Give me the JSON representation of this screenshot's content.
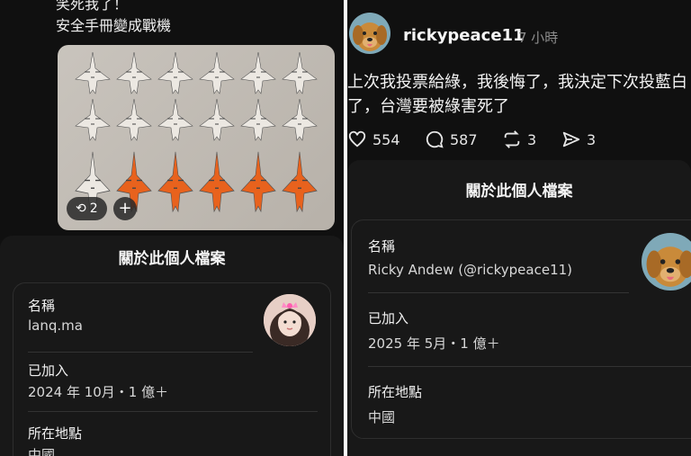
{
  "left": {
    "post_lines": [
      "笑死我了！",
      "安全手冊變成戰機"
    ],
    "media": {
      "repost_count": "2",
      "add_label": "+"
    },
    "profile_sheet": {
      "title": "關於此個人檔案",
      "name_label": "名稱",
      "name_value": "lanq.ma",
      "joined_label": "已加入",
      "joined_value": "2024 年 10月・1 億＋",
      "location_label": "所在地點",
      "location_value": "中國"
    }
  },
  "right": {
    "post": {
      "username": "rickypeace11",
      "time": "7 小時",
      "body": "上次我投票給綠，我後悔了，我決定下次投藍白了，台灣要被綠害死了",
      "likes": "554",
      "comments": "587",
      "reposts": "3",
      "shares": "3"
    },
    "profile_sheet": {
      "title": "關於此個人檔案",
      "name_label": "名稱",
      "name_value": "Ricky Andew (@rickypeace11)",
      "joined_label": "已加入",
      "joined_value": "2025 年 5月・1 億＋",
      "location_label": "所在地點",
      "location_value": "中國"
    }
  },
  "colors": {
    "orange_plane": "#e8621d",
    "white_plane": "#ece8e2",
    "dog_fur": "#c98a3a"
  },
  "icons": [
    "heart-icon",
    "comment-icon",
    "repost-icon",
    "share-icon",
    "plus-icon"
  ]
}
